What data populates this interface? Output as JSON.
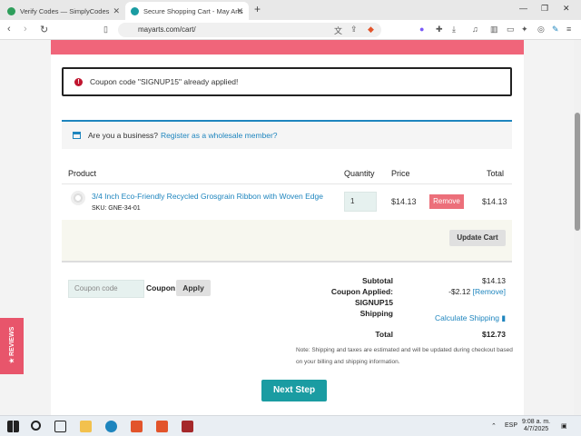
{
  "browser": {
    "tabs": [
      {
        "title": "Verify Codes — SimplyCodes",
        "icon": "simplycodes-icon",
        "color": "#2e9e5b"
      },
      {
        "title": "Secure Shopping Cart - May Arts",
        "icon": "mayarts-icon",
        "color": "#1a9ca2"
      }
    ],
    "new_tab": "+",
    "url": "mayarts.com/cart/"
  },
  "alerts": {
    "error": "Coupon code \"SIGNUP15\" already applied!",
    "info_prefix": "Are you a business?",
    "info_link": "Register as a wholesale member?"
  },
  "cart": {
    "headers": {
      "product": "Product",
      "quantity": "Quantity",
      "price": "Price",
      "total": "Total"
    },
    "item": {
      "name": "3/4 Inch Eco-Friendly Recycled Grosgrain Ribbon with Woven Edge",
      "sku": "SKU: GNE-34-01",
      "quantity": "1",
      "price": "$14.13",
      "remove": "Remove",
      "total": "$14.13"
    },
    "update_button": "Update Cart"
  },
  "coupon": {
    "placeholder": "Coupon code",
    "label": "Coupon:",
    "apply": "Apply"
  },
  "totals": {
    "subtotal_label": "Subtotal",
    "subtotal_value": "$14.13",
    "coupon_label": "Coupon Applied:",
    "coupon_code": "SIGNUP15",
    "coupon_value": "-$2.12",
    "coupon_remove": "[Remove]",
    "shipping_label": "Shipping",
    "shipping_value": "Calculate Shipping",
    "total_label": "Total",
    "total_value": "$12.73",
    "note": "Note: Shipping and taxes are estimated and will be updated during checkout based on your billing and shipping information."
  },
  "next_step": "Next Step",
  "reviews_tab": "★ REVIEWS",
  "taskbar": {
    "language": "ESP",
    "time": "9:08 a. m.",
    "date": "4/7/2025"
  }
}
